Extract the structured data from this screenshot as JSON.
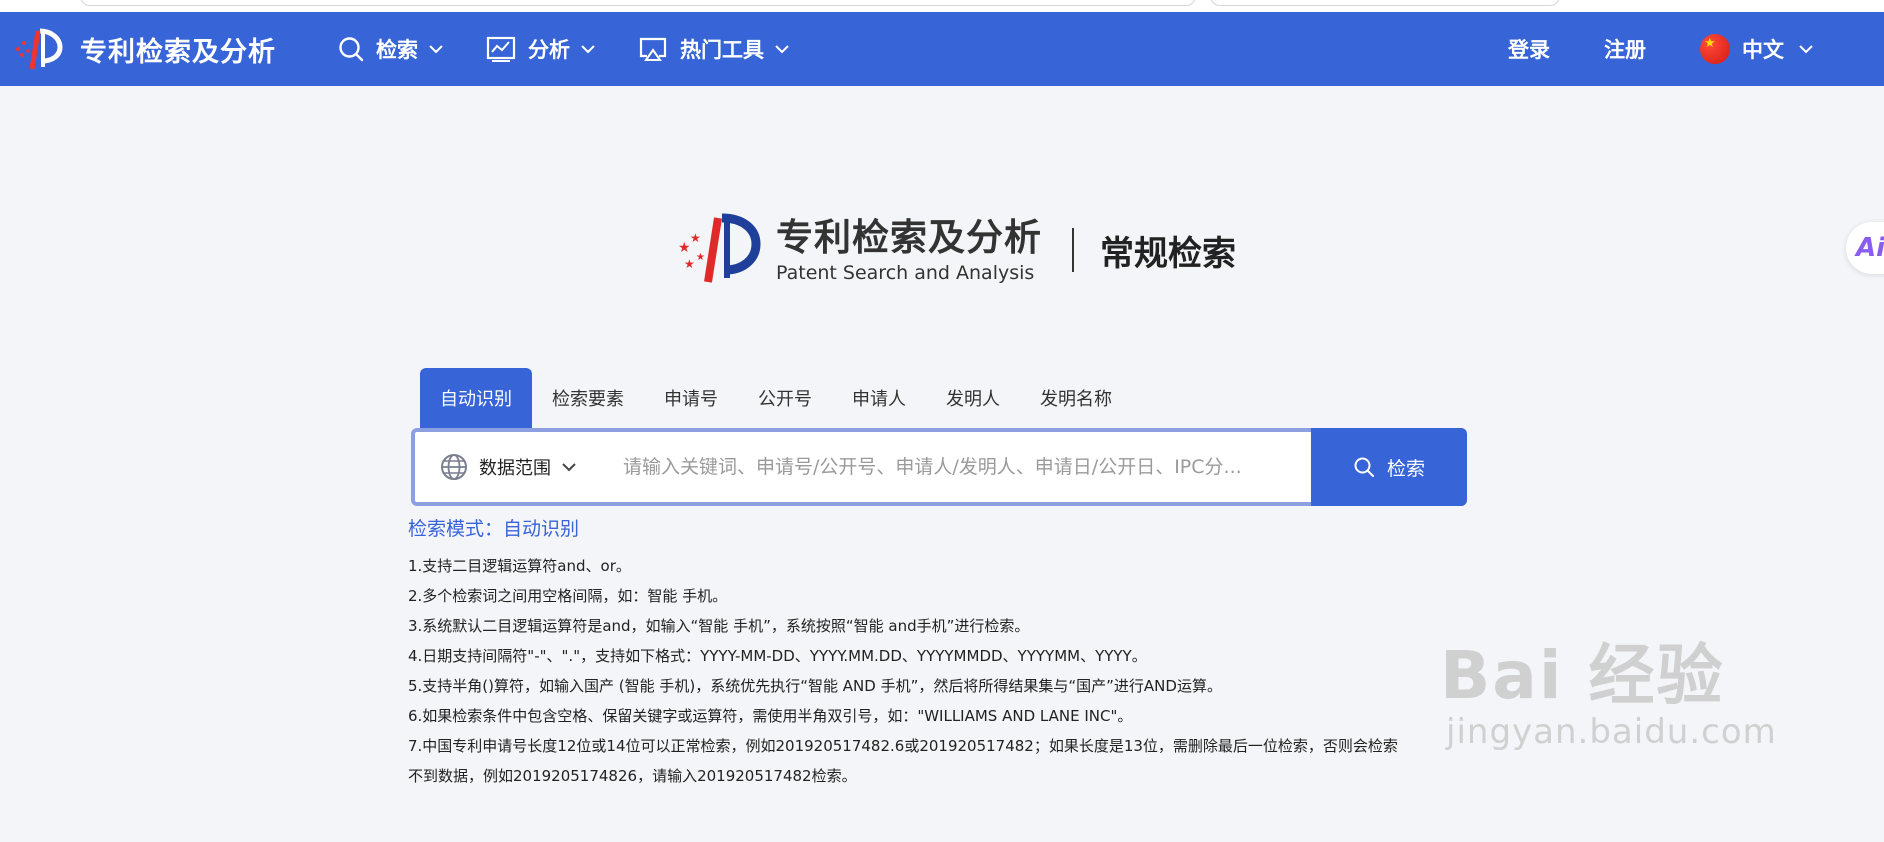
{
  "nav": {
    "brand_title": "专利检索及分析",
    "menu": [
      {
        "label": "检索",
        "icon": "search-icon"
      },
      {
        "label": "分析",
        "icon": "chart-icon"
      },
      {
        "label": "热门工具",
        "icon": "screen-cast-icon"
      }
    ],
    "login": "登录",
    "register": "注册",
    "language": "中文"
  },
  "hero": {
    "title_cn": "专利检索及分析",
    "title_en": "Patent Search and Analysis",
    "mode_title": "常规检索"
  },
  "tabs": [
    {
      "label": "自动识别",
      "active": true
    },
    {
      "label": "检索要素",
      "active": false
    },
    {
      "label": "申请号",
      "active": false
    },
    {
      "label": "公开号",
      "active": false
    },
    {
      "label": "申请人",
      "active": false
    },
    {
      "label": "发明人",
      "active": false
    },
    {
      "label": "发明名称",
      "active": false
    }
  ],
  "search": {
    "scope_label": "数据范围",
    "placeholder": "请输入关键词、申请号/公开号、申请人/发明人、申请日/公开日、IPC分...",
    "button_label": "检索"
  },
  "help": {
    "title": "检索模式：自动识别",
    "lines": [
      "1.支持二目逻辑运算符and、or。",
      "2.多个检索词之间用空格间隔，如：智能 手机。",
      "3.系统默认二目逻辑运算符是and，如输入“智能 手机”，系统按照“智能 and手机”进行检索。",
      "4.日期支持间隔符\"-\"、\".\"，支持如下格式：YYYY-MM-DD、YYYY.MM.DD、YYYYMMDD、YYYYMM、YYYY。",
      "5.支持半角()算符，如输入国产 (智能 手机)，系统优先执行“智能 AND 手机”，然后将所得结果集与“国产”进行AND运算。",
      "6.如果检索条件中包含空格、保留关键字或运算符，需使用半角双引号，如：\"WILLIAMS AND LANE INC\"。",
      "7.中国专利申请号长度12位或14位可以正常检索，例如201920517482.6或201920517482；如果长度是13位，需删除最后一位检索，否则会检索",
      "不到数据，例如2019205174826，请输入201920517482检索。"
    ]
  },
  "ai_widget": {
    "label": "Ai"
  },
  "watermark": {
    "main": "Bai 经验",
    "sub": "jingyan.baidu.com"
  },
  "colors": {
    "primary": "#3764d6",
    "input_border": "#8c9fe0",
    "background": "#f4f5f8"
  }
}
